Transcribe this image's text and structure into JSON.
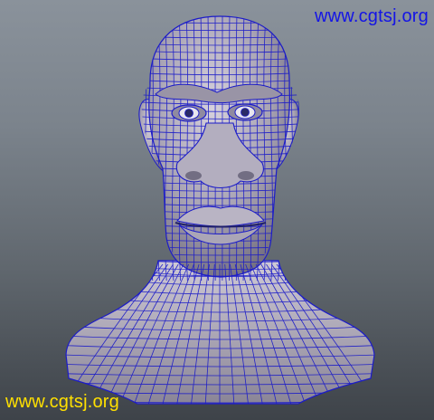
{
  "viewport": {
    "background_top": "#8a929b",
    "background_bottom": "#3e4349"
  },
  "model": {
    "description_icon": "wireframe-shaded-head-mesh",
    "shade_color": "#a8a4b2",
    "wireframe_color": "#1c1cc8"
  },
  "watermarks": {
    "top_text": "www.cgtsj.org",
    "top_color": "#1414e6",
    "bottom_text": "www.cgtsj.org",
    "bottom_color": "#ffe000"
  }
}
